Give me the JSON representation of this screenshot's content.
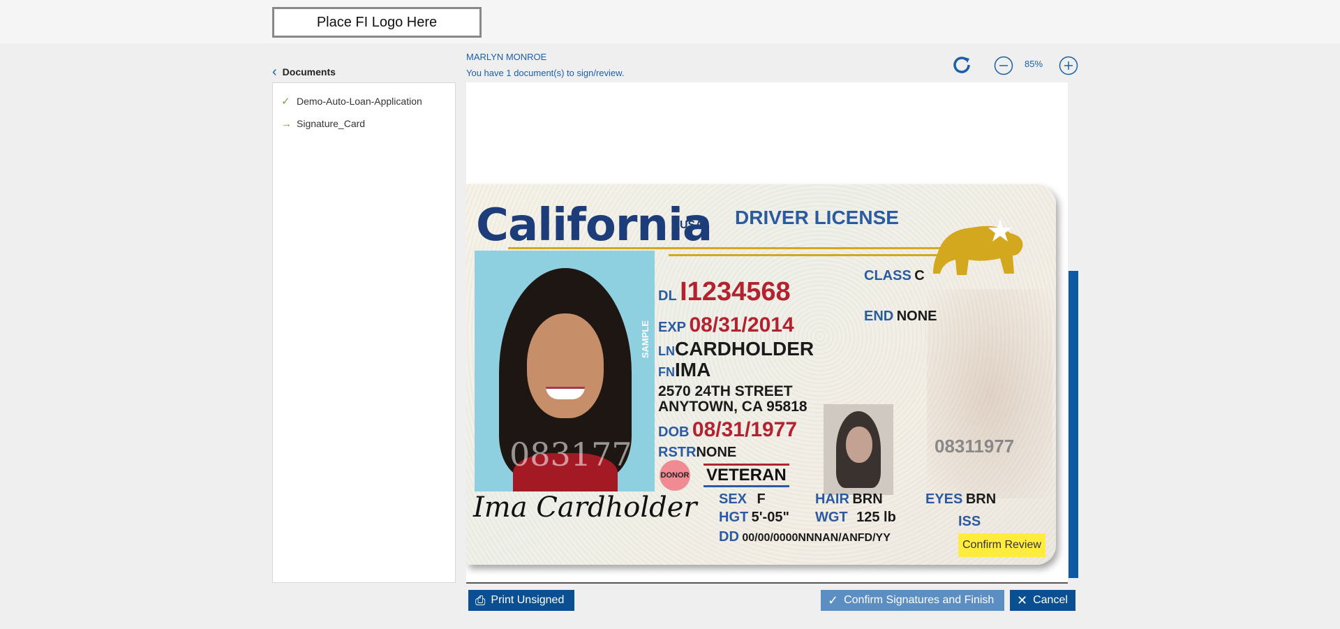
{
  "header": {
    "logo_placeholder": "Place FI Logo Here"
  },
  "sidebar": {
    "title": "Documents",
    "items": [
      {
        "label": "Demo-Auto-Loan-Application",
        "status_icon": "check-icon"
      },
      {
        "label": "Signature_Card",
        "status_icon": "arrow-right-icon"
      }
    ]
  },
  "viewer": {
    "user_name": "MARLYN MONROE",
    "message": "You have 1 document(s) to sign/review.",
    "zoom": "85%",
    "confirm_review_label": "Confirm Review"
  },
  "license": {
    "state": "California",
    "country": "USA",
    "title": "DRIVER LICENSE",
    "dl_label": "DL",
    "dl_number": "I1234568",
    "exp_label": "EXP",
    "exp": "08/31/2014",
    "class_label": "CLASS",
    "class": "C",
    "end_label": "END",
    "end": "NONE",
    "ln_label": "LN",
    "ln": "CARDHOLDER",
    "fn_label": "FN",
    "fn": "IMA",
    "address1": "2570 24TH STREET",
    "address2": "ANYTOWN, CA 95818",
    "dob_label": "DOB",
    "dob": "08/31/1977",
    "rstr_label": "RSTR",
    "rstr": "NONE",
    "donor": "DONOR",
    "veteran": "VETERAN",
    "sex_label": "SEX",
    "sex": "F",
    "hair_label": "HAIR",
    "hair": "BRN",
    "eyes_label": "EYES",
    "eyes": "BRN",
    "hgt_label": "HGT",
    "hgt": "5'-05\"",
    "wgt_label": "WGT",
    "wgt": "125 lb",
    "dd_label": "DD",
    "dd": "00/00/0000NNNAN/ANFD/YY",
    "iss_label": "ISS",
    "ghost_number": "08311977",
    "photo_watermark": "083177",
    "sample": "SAMPLE",
    "signature": "Ima Cardholder"
  },
  "footer": {
    "print_label": "Print Unsigned",
    "confirm_label": "Confirm Signatures and Finish",
    "cancel_label": "Cancel"
  },
  "colors": {
    "accent": "#0b4f93",
    "link": "#1b5fa8",
    "highlight": "#ffec3d"
  }
}
